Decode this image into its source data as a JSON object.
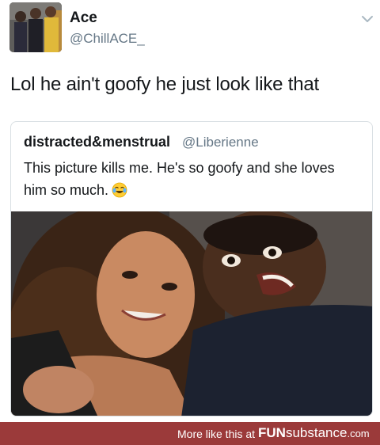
{
  "tweet": {
    "display_name": "Ace",
    "handle": "@ChillACE_",
    "text": "Lol he ain't goofy he just look like that"
  },
  "quoted_tweet": {
    "display_name": "distracted&menstrual",
    "handle": "@Liberienne",
    "text": "This picture kills me. He's so goofy and she loves him so much.",
    "emoji_icon": "tears-of-joy-emoji"
  },
  "footer": {
    "prefix": "More like this at",
    "brand_bold": "FUN",
    "brand_thin": "substance",
    "brand_domain": ".com",
    "background": "#9b3a3a"
  },
  "colors": {
    "text": "#14171a",
    "secondary": "#657786",
    "border": "#d9dfe3"
  }
}
